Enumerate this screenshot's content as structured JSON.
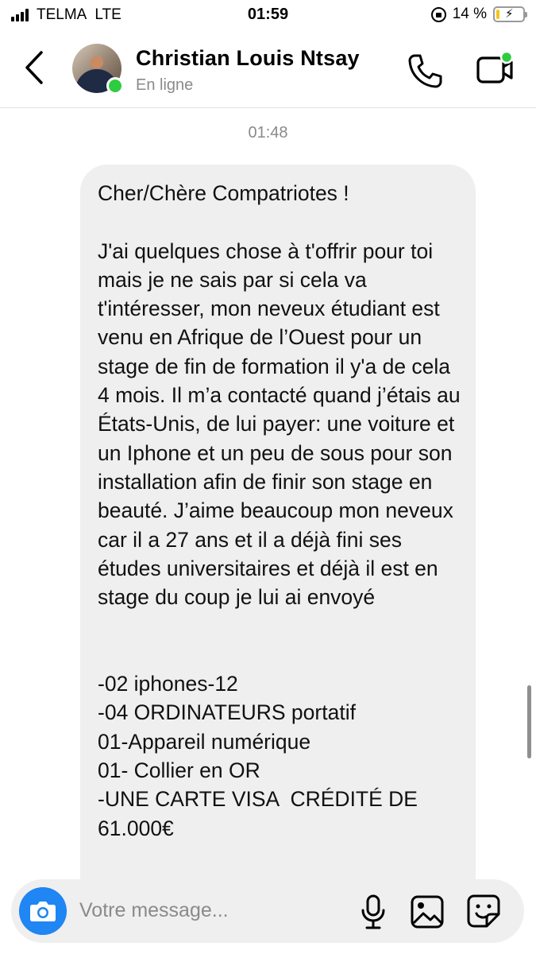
{
  "status_bar": {
    "carrier": "TELMA",
    "network": "LTE",
    "time": "01:59",
    "battery_percent": "14 %",
    "battery_level": 0.14,
    "signal_bars": 4
  },
  "header": {
    "contact_name": "Christian Louis Ntsay",
    "contact_status": "En ligne",
    "online_color": "#2ecc40"
  },
  "chat": {
    "timestamp": "01:48",
    "message": "Cher/Chère Compatriotes !\n\nJ'ai quelques chose à t'offrir pour toi mais je ne sais par si cela va t'intéresser, mon neveux étudiant est venu en Afrique de l’Ouest pour un stage de fin de formation il y'a de cela 4 mois. Il m’a contacté quand j’étais au États-Unis, de lui payer: une voiture et un Iphone et un peu de sous pour son installation afin de finir son stage en beauté. J’aime beaucoup mon neveux car il a 27 ans et il a déjà fini ses études universitaires et déjà il est en stage du coup je lui ai envoyé\n\n\n-02 iphones-12\n-04 ORDINATEURS portatif\n01-Appareil numérique\n01- Collier en OR\n-UNE CARTE VISA  CRÉDITÉ DE 61.000€"
  },
  "composer": {
    "placeholder": "Votre message...",
    "camera_color": "#1f86f3"
  },
  "icons": {
    "back": "chevron-left-icon",
    "call": "phone-icon",
    "video": "video-camera-icon",
    "camera": "camera-icon",
    "mic": "microphone-icon",
    "gallery": "image-icon",
    "sticker": "sticker-icon"
  }
}
